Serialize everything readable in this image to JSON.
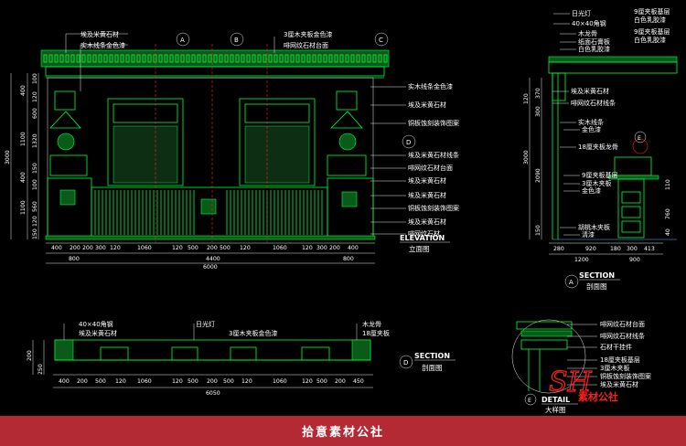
{
  "elevation": {
    "callouts_left": [
      "埃及米黄石材",
      "实木线条金色漆"
    ],
    "callouts_top": [
      "3厘木夹板金色漆",
      "啡网纹石材台面"
    ],
    "markers": [
      "A",
      "B",
      "C",
      "D"
    ],
    "callouts_right": [
      "实木线条金色漆",
      "埃及米黄石材",
      "铜板蚀刻装饰图案",
      "埃及米黄石材线条",
      "啡网纹石材台面",
      "埃及米黄石材",
      "埃及米黄石材",
      "铜板蚀刻装饰图案",
      "埃及米黄石材",
      "啡网纹石材"
    ],
    "left_dims_outer": [
      "3000",
      "1100",
      "1100",
      "400",
      "400"
    ],
    "left_dims_inner": [
      "100",
      "120",
      "600",
      "1320",
      "150",
      "100",
      "560",
      "120",
      "150"
    ],
    "bottom_dims_1": [
      "400",
      "200",
      "200",
      "300",
      "120",
      "1060",
      "120",
      "500",
      "200",
      "500",
      "120",
      "1060",
      "120",
      "300",
      "200",
      "400"
    ],
    "bottom_dims_2": [
      "800",
      "4400",
      "800"
    ],
    "bottom_total": "6000",
    "title": "ELEVATION",
    "subtitle": "立面图"
  },
  "section_a": {
    "callouts": [
      "日光灯",
      "40×40角钢",
      "木龙骨",
      "纸面石膏板",
      "白色乳胶漆",
      "9厘夹板基层",
      "白色乳胶漆",
      "9厘夹板基层",
      "白色乳胶漆",
      "埃及米黄石材",
      "啡网纹石材线条",
      "实木线条",
      "金色漆",
      "18厘夹板龙骨",
      "9厘夹板基层",
      "3厘木夹板",
      "金色漆",
      "胡桃木夹板",
      "清漆"
    ],
    "left_dims": [
      "370",
      "300",
      "120",
      "3000",
      "2090",
      "150"
    ],
    "right_dims": [
      "760",
      "110",
      "40"
    ],
    "bottom_dims_1": [
      "280",
      "920",
      "180",
      "300",
      "413"
    ],
    "bottom_dims_2": [
      "1200",
      "900"
    ],
    "marker": "A",
    "marker2": "E",
    "title": "SECTION",
    "subtitle": "剖面图"
  },
  "section_d": {
    "callouts_left": [
      "40×40角钢",
      "埃及米黄石材"
    ],
    "callouts_mid": [
      "日光灯",
      "3厘木夹板金色漆"
    ],
    "callouts_right": [
      "木龙骨",
      "18厘夹板"
    ],
    "left_dims": [
      "200",
      "250"
    ],
    "bottom_dims": [
      "400",
      "200",
      "500",
      "120",
      "1060",
      "120",
      "500",
      "200",
      "500",
      "120",
      "1060",
      "120",
      "500",
      "200",
      "450"
    ],
    "bottom_total": "6050",
    "marker": "D",
    "title": "SECTION",
    "subtitle": "剖面图"
  },
  "detail_e": {
    "callouts": [
      "啡网纹石材台面",
      "啡网纹石材线条",
      "石材干挂件",
      "18厘夹板基层",
      "3厘木夹板",
      "铜板蚀刻装饰图案",
      "埃及米黄石材"
    ],
    "marker": "E",
    "title": "DETAIL",
    "subtitle": "大样图"
  },
  "logo": {
    "mark": "SH",
    "text": "素材公社"
  },
  "footer": {
    "text": "拾意素材公社"
  },
  "colors": {
    "background": "#000000",
    "linework": "#00ff3c",
    "footer": "#b32a35",
    "logo_red": "#ff2020"
  }
}
